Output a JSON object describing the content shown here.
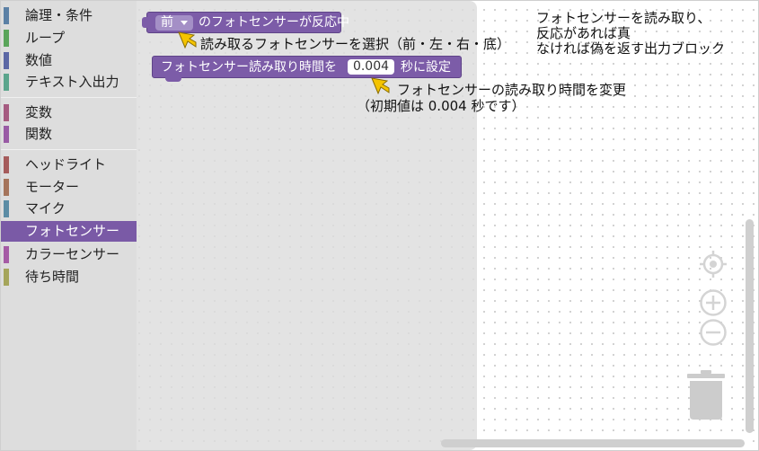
{
  "toolbox": {
    "categories": [
      {
        "label": "論理・条件",
        "color": "#5b80a5"
      },
      {
        "label": "ループ",
        "color": "#5ba55b"
      },
      {
        "label": "数値",
        "color": "#5b67a5"
      },
      {
        "label": "テキスト入出力",
        "color": "#5ba58c"
      },
      {
        "label": "変数",
        "color": "#a55b80"
      },
      {
        "label": "関数",
        "color": "#995ba5"
      },
      {
        "label": "ヘッドライト",
        "color": "#a55b5b"
      },
      {
        "label": "モーター",
        "color": "#a5745b"
      },
      {
        "label": "マイク",
        "color": "#5b8ca5"
      },
      {
        "label": "フォトセンサー",
        "color": "#7a5aa6",
        "selected": true
      },
      {
        "label": "カラーセンサー",
        "color": "#a55ba5"
      },
      {
        "label": "待ち時間",
        "color": "#a5a55b"
      }
    ]
  },
  "blocks": {
    "sensor_reacted": {
      "dropdown_value": "前",
      "text": "のフォトセンサーが反応中"
    },
    "set_read_time": {
      "text_before": "フォトセンサー読み取り時間を",
      "value": "0.004",
      "text_after": "秒に設定"
    }
  },
  "annotations": {
    "sensor_select": "読み取るフォトセンサーを選択（前・左・右・底）",
    "output_block": [
      "フォトセンサーを読み取り、",
      "反応があれば真",
      "なければ偽を返す出力ブロック"
    ],
    "read_time_change": [
      "フォトセンサーの読み取り時間を変更",
      "（初期値は 0.004 秒です）"
    ]
  },
  "colors": {
    "block": "#7c5ca8",
    "arrow": "#f5c400",
    "selected_category": "#7a5aa6"
  },
  "controls": {
    "recenter": "crosshair-icon",
    "zoom_in": "zoom-in-icon",
    "zoom_out": "zoom-out-icon",
    "trash": "trash-icon"
  }
}
